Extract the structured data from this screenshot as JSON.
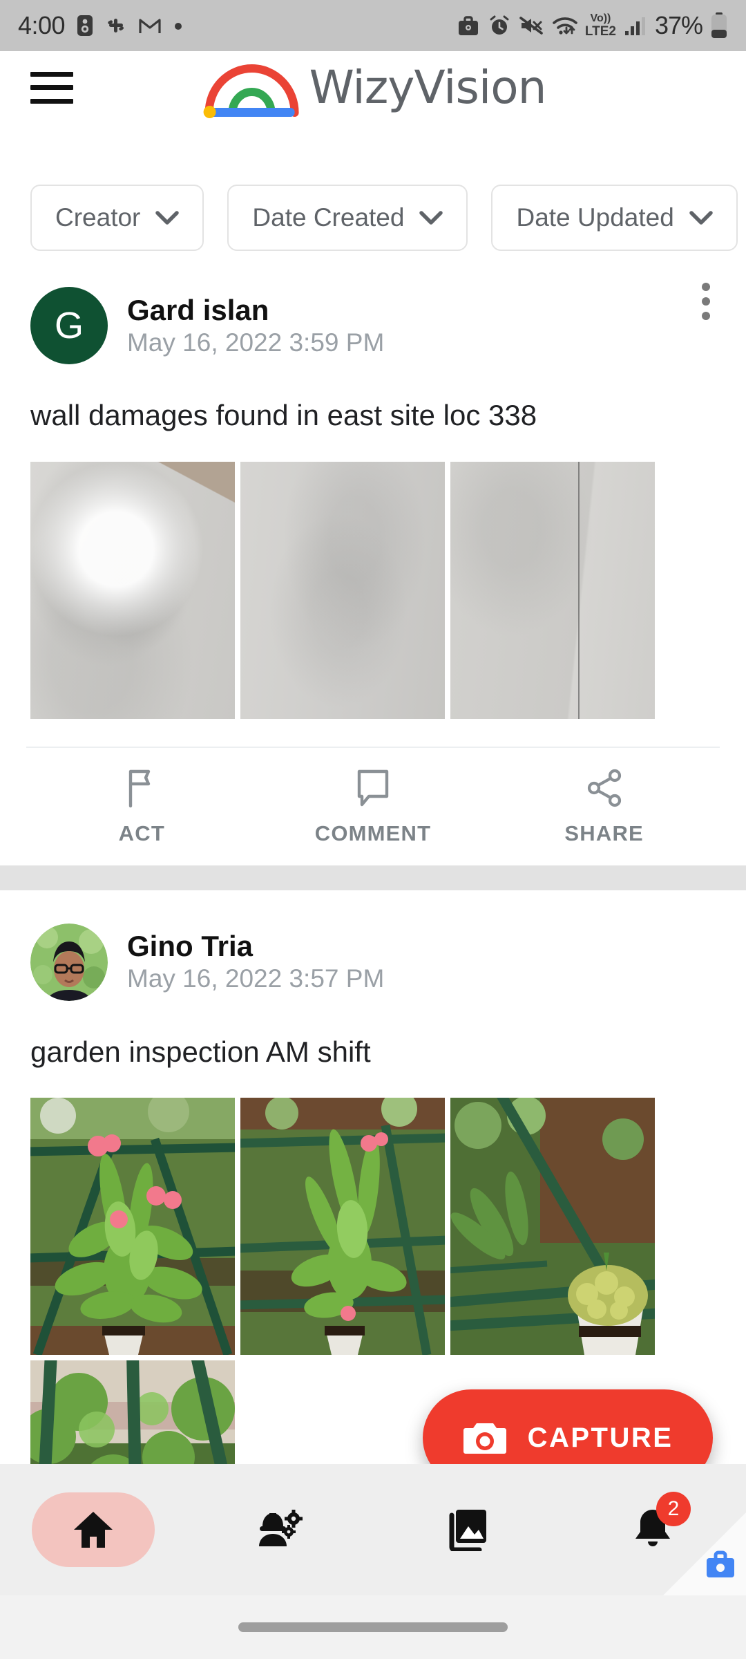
{
  "status_bar": {
    "time": "4:00",
    "battery_percent": "37%",
    "network_label_top": "Vo))",
    "network_label_bottom": "LTE2",
    "left_icons": [
      "work-profile-icon",
      "slack-icon",
      "gmail-icon",
      "dot-icon"
    ],
    "right_icons": [
      "work-briefcase-icon",
      "alarm-icon",
      "mute-icon",
      "wifi-icon",
      "volte-icon",
      "signal-icon",
      "battery-icon"
    ]
  },
  "header": {
    "menu_icon": "hamburger-menu-icon",
    "logo_icon": "wizyvision-arch-logo",
    "brand": {
      "part1": "Wizy",
      "part2": "Vision",
      "full": "WizyVision"
    }
  },
  "filters": [
    {
      "label": "Creator",
      "icon": "chevron-down-icon"
    },
    {
      "label": "Date Created",
      "icon": "chevron-down-icon"
    },
    {
      "label": "Date Updated",
      "icon": "chevron-down-icon"
    }
  ],
  "posts": [
    {
      "author": "Gard islan",
      "avatar_initial": "G",
      "avatar_color": "#0f5132",
      "timestamp": "May 16, 2022 3:59 PM",
      "text": "wall damages found in east site loc 338",
      "menu_icon": "kebab-menu-icon",
      "images": [
        "wall-damage-photo-1",
        "wall-damage-photo-2",
        "wall-damage-photo-3"
      ],
      "actions": [
        {
          "label": "ACT",
          "icon": "flag-icon"
        },
        {
          "label": "COMMENT",
          "icon": "comment-bubble-icon"
        },
        {
          "label": "SHARE",
          "icon": "share-icon"
        }
      ]
    },
    {
      "author": "Gino Tria",
      "avatar_initial": "",
      "timestamp": "May 16, 2022 3:57 PM",
      "text": "garden inspection AM shift",
      "menu_icon": "kebab-menu-icon",
      "images": [
        "garden-plant-photo-1",
        "garden-plant-photo-2",
        "garden-plant-photo-3",
        "garden-plant-photo-4"
      ],
      "actions": []
    }
  ],
  "capture_button": {
    "label": "CAPTURE",
    "icon": "camera-icon",
    "color": "#ef3b2d"
  },
  "bottom_nav": [
    {
      "name": "home",
      "icon": "home-icon",
      "active": true
    },
    {
      "name": "tasks",
      "icon": "worker-gear-icon",
      "active": false
    },
    {
      "name": "gallery",
      "icon": "photo-library-icon",
      "active": false
    },
    {
      "name": "notifications",
      "icon": "bell-icon",
      "active": false,
      "badge": "2"
    }
  ],
  "work_profile_badge": {
    "icon": "work-briefcase-icon",
    "color": "#4285f4"
  },
  "colors": {
    "accent": "#ef3b2d",
    "active_pill": "#f3c4bf",
    "status_bar_bg": "#c4c4c4",
    "nav_bg": "#eeeeee",
    "muted_text": "#9aa0a6"
  }
}
